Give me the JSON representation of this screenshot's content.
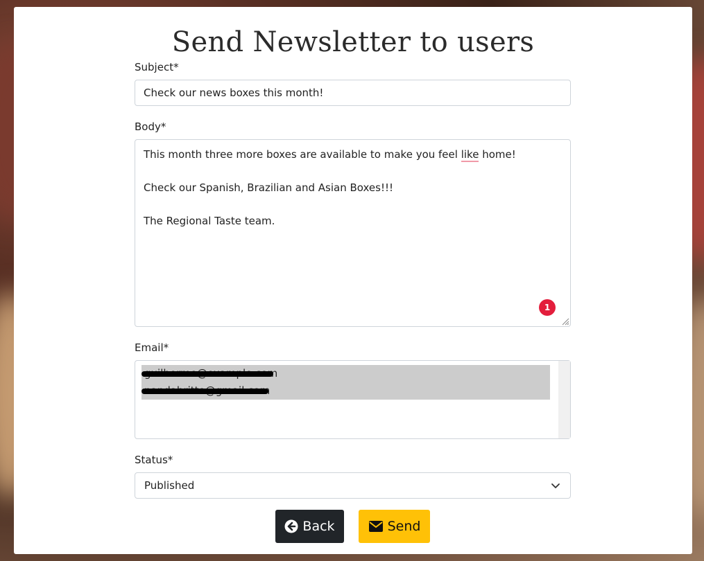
{
  "page": {
    "title": "Send Newsletter to users"
  },
  "form": {
    "subject_label": "Subject*",
    "subject_value": "Check our news boxes this month!",
    "body_label": "Body*",
    "body_lines": {
      "line1_before": "This month three more boxes are available to make you feel ",
      "line1_flagged": "like",
      "line1_after": " home!",
      "line2": "",
      "line3": "Check our Spanish, Brazilian and Asian Boxes!!!",
      "line4": "",
      "line5": "The Regional Taste team."
    },
    "grammar_badge_count": "1",
    "email_label": "Email*",
    "email_options": [
      "guilherme@example.com",
      "nandabritto@gmail.com"
    ],
    "status_label": "Status*",
    "status_value": "Published"
  },
  "buttons": {
    "back_label": "Back",
    "send_label": "Send"
  },
  "colors": {
    "back_button": "#212529",
    "send_button": "#ffc107",
    "grammar_badge": "#e31e3c",
    "selected_option": "#cccccc"
  }
}
